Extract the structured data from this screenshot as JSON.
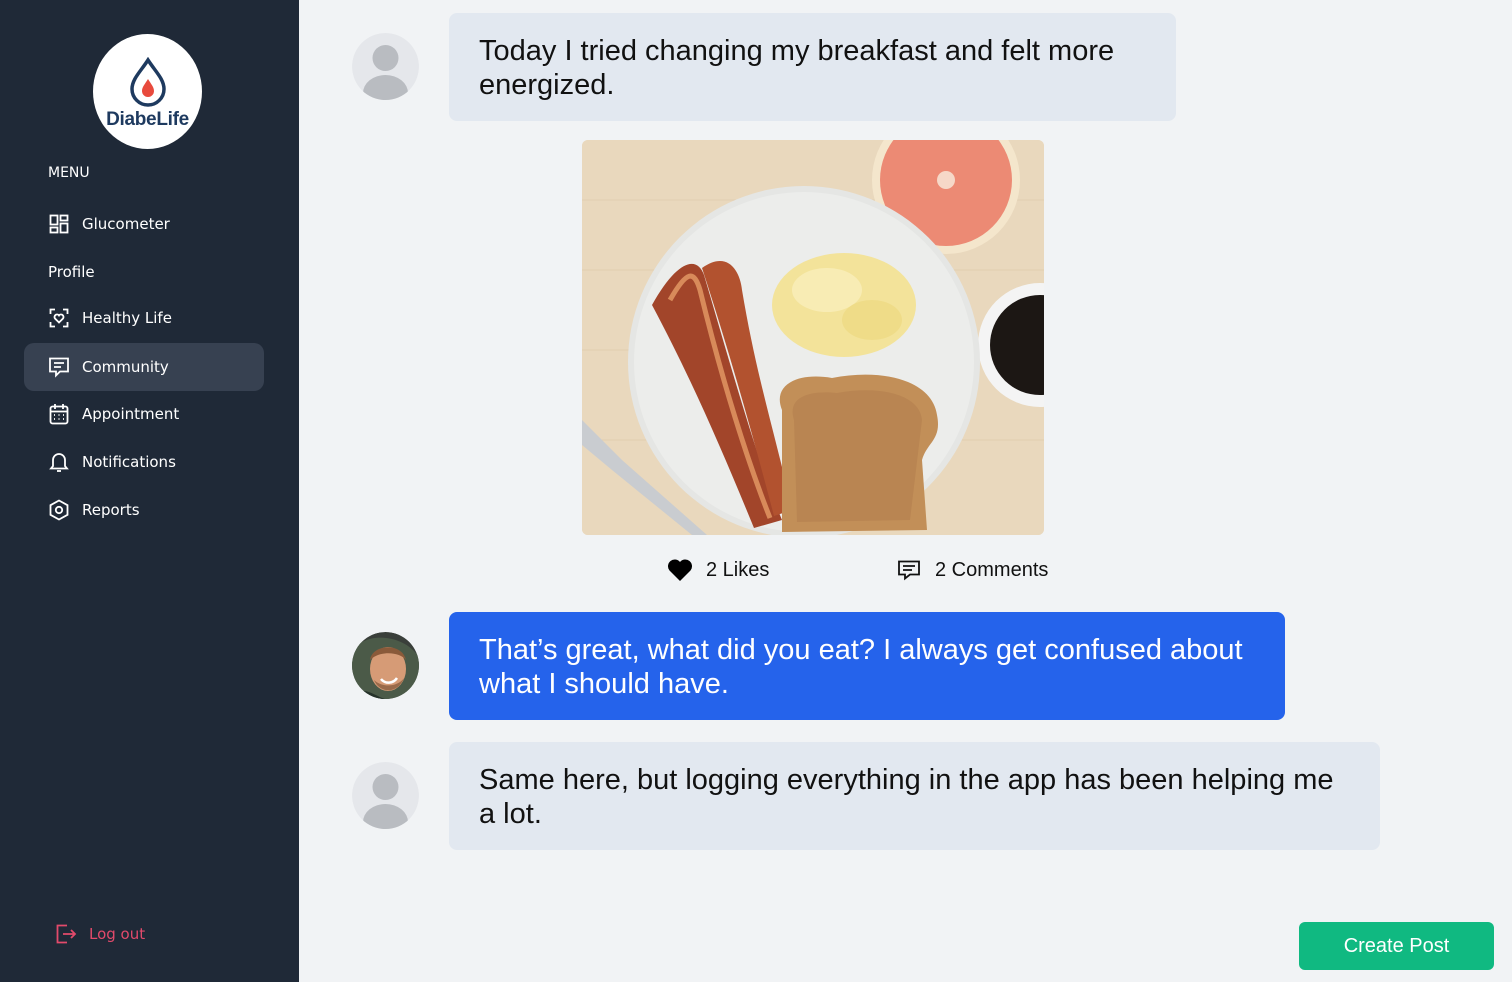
{
  "app": {
    "logo_text": "DiabeLife"
  },
  "sidebar": {
    "menu_label": "MENU",
    "items": [
      {
        "label": "Glucometer",
        "icon": "dashboard-grid-icon"
      },
      {
        "label": "Profile"
      },
      {
        "label": "Healthy Life",
        "icon": "heart-scan-icon"
      },
      {
        "label": "Community",
        "icon": "message-square-icon",
        "active": true
      },
      {
        "label": "Appointment",
        "icon": "calendar-icon"
      },
      {
        "label": "Notifications",
        "icon": "bell-icon"
      },
      {
        "label": "Reports",
        "icon": "hexagon-icon"
      }
    ],
    "logout_label": "Log out"
  },
  "feed": {
    "post": {
      "text": "Today I tried changing my breakfast and felt more energized.",
      "image_alt": "Breakfast plate with bacon, scrambled eggs, toast, grapefruit and coffee",
      "likes_label": "2 Likes",
      "comments_label": "2 Comments"
    },
    "comments": [
      {
        "text": "That’s great, what did you eat? I always get confused about what I should have.",
        "style": "blue"
      },
      {
        "text": "Same here, but logging everything in the app has been helping me a lot.",
        "style": "gray"
      }
    ]
  },
  "actions": {
    "create_post_label": "Create Post"
  },
  "colors": {
    "sidebar_bg": "#1f2937",
    "active_item_bg": "#374151",
    "accent_blue": "#2563eb",
    "create_green": "#10b981",
    "logout_red": "#e24a6b",
    "bubble_gray": "#e2e8f0"
  }
}
